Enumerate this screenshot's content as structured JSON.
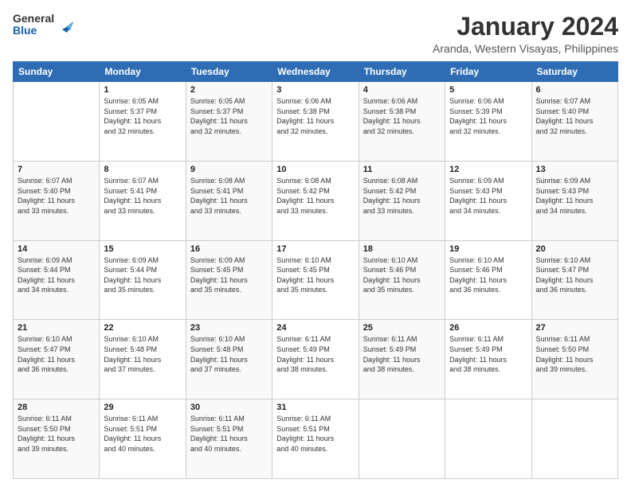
{
  "header": {
    "logo_line1": "General",
    "logo_line2": "Blue",
    "title": "January 2024",
    "subtitle": "Aranda, Western Visayas, Philippines"
  },
  "weekdays": [
    "Sunday",
    "Monday",
    "Tuesday",
    "Wednesday",
    "Thursday",
    "Friday",
    "Saturday"
  ],
  "weeks": [
    [
      {
        "day": "",
        "info": ""
      },
      {
        "day": "1",
        "info": "Sunrise: 6:05 AM\nSunset: 5:37 PM\nDaylight: 11 hours\nand 32 minutes."
      },
      {
        "day": "2",
        "info": "Sunrise: 6:05 AM\nSunset: 5:37 PM\nDaylight: 11 hours\nand 32 minutes."
      },
      {
        "day": "3",
        "info": "Sunrise: 6:06 AM\nSunset: 5:38 PM\nDaylight: 11 hours\nand 32 minutes."
      },
      {
        "day": "4",
        "info": "Sunrise: 6:06 AM\nSunset: 5:38 PM\nDaylight: 11 hours\nand 32 minutes."
      },
      {
        "day": "5",
        "info": "Sunrise: 6:06 AM\nSunset: 5:39 PM\nDaylight: 11 hours\nand 32 minutes."
      },
      {
        "day": "6",
        "info": "Sunrise: 6:07 AM\nSunset: 5:40 PM\nDaylight: 11 hours\nand 32 minutes."
      }
    ],
    [
      {
        "day": "7",
        "info": "Sunrise: 6:07 AM\nSunset: 5:40 PM\nDaylight: 11 hours\nand 33 minutes."
      },
      {
        "day": "8",
        "info": "Sunrise: 6:07 AM\nSunset: 5:41 PM\nDaylight: 11 hours\nand 33 minutes."
      },
      {
        "day": "9",
        "info": "Sunrise: 6:08 AM\nSunset: 5:41 PM\nDaylight: 11 hours\nand 33 minutes."
      },
      {
        "day": "10",
        "info": "Sunrise: 6:08 AM\nSunset: 5:42 PM\nDaylight: 11 hours\nand 33 minutes."
      },
      {
        "day": "11",
        "info": "Sunrise: 6:08 AM\nSunset: 5:42 PM\nDaylight: 11 hours\nand 33 minutes."
      },
      {
        "day": "12",
        "info": "Sunrise: 6:09 AM\nSunset: 5:43 PM\nDaylight: 11 hours\nand 34 minutes."
      },
      {
        "day": "13",
        "info": "Sunrise: 6:09 AM\nSunset: 5:43 PM\nDaylight: 11 hours\nand 34 minutes."
      }
    ],
    [
      {
        "day": "14",
        "info": "Sunrise: 6:09 AM\nSunset: 5:44 PM\nDaylight: 11 hours\nand 34 minutes."
      },
      {
        "day": "15",
        "info": "Sunrise: 6:09 AM\nSunset: 5:44 PM\nDaylight: 11 hours\nand 35 minutes."
      },
      {
        "day": "16",
        "info": "Sunrise: 6:09 AM\nSunset: 5:45 PM\nDaylight: 11 hours\nand 35 minutes."
      },
      {
        "day": "17",
        "info": "Sunrise: 6:10 AM\nSunset: 5:45 PM\nDaylight: 11 hours\nand 35 minutes."
      },
      {
        "day": "18",
        "info": "Sunrise: 6:10 AM\nSunset: 5:46 PM\nDaylight: 11 hours\nand 35 minutes."
      },
      {
        "day": "19",
        "info": "Sunrise: 6:10 AM\nSunset: 5:46 PM\nDaylight: 11 hours\nand 36 minutes."
      },
      {
        "day": "20",
        "info": "Sunrise: 6:10 AM\nSunset: 5:47 PM\nDaylight: 11 hours\nand 36 minutes."
      }
    ],
    [
      {
        "day": "21",
        "info": "Sunrise: 6:10 AM\nSunset: 5:47 PM\nDaylight: 11 hours\nand 36 minutes."
      },
      {
        "day": "22",
        "info": "Sunrise: 6:10 AM\nSunset: 5:48 PM\nDaylight: 11 hours\nand 37 minutes."
      },
      {
        "day": "23",
        "info": "Sunrise: 6:10 AM\nSunset: 5:48 PM\nDaylight: 11 hours\nand 37 minutes."
      },
      {
        "day": "24",
        "info": "Sunrise: 6:11 AM\nSunset: 5:49 PM\nDaylight: 11 hours\nand 38 minutes."
      },
      {
        "day": "25",
        "info": "Sunrise: 6:11 AM\nSunset: 5:49 PM\nDaylight: 11 hours\nand 38 minutes."
      },
      {
        "day": "26",
        "info": "Sunrise: 6:11 AM\nSunset: 5:49 PM\nDaylight: 11 hours\nand 38 minutes."
      },
      {
        "day": "27",
        "info": "Sunrise: 6:11 AM\nSunset: 5:50 PM\nDaylight: 11 hours\nand 39 minutes."
      }
    ],
    [
      {
        "day": "28",
        "info": "Sunrise: 6:11 AM\nSunset: 5:50 PM\nDaylight: 11 hours\nand 39 minutes."
      },
      {
        "day": "29",
        "info": "Sunrise: 6:11 AM\nSunset: 5:51 PM\nDaylight: 11 hours\nand 40 minutes."
      },
      {
        "day": "30",
        "info": "Sunrise: 6:11 AM\nSunset: 5:51 PM\nDaylight: 11 hours\nand 40 minutes."
      },
      {
        "day": "31",
        "info": "Sunrise: 6:11 AM\nSunset: 5:51 PM\nDaylight: 11 hours\nand 40 minutes."
      },
      {
        "day": "",
        "info": ""
      },
      {
        "day": "",
        "info": ""
      },
      {
        "day": "",
        "info": ""
      }
    ]
  ]
}
